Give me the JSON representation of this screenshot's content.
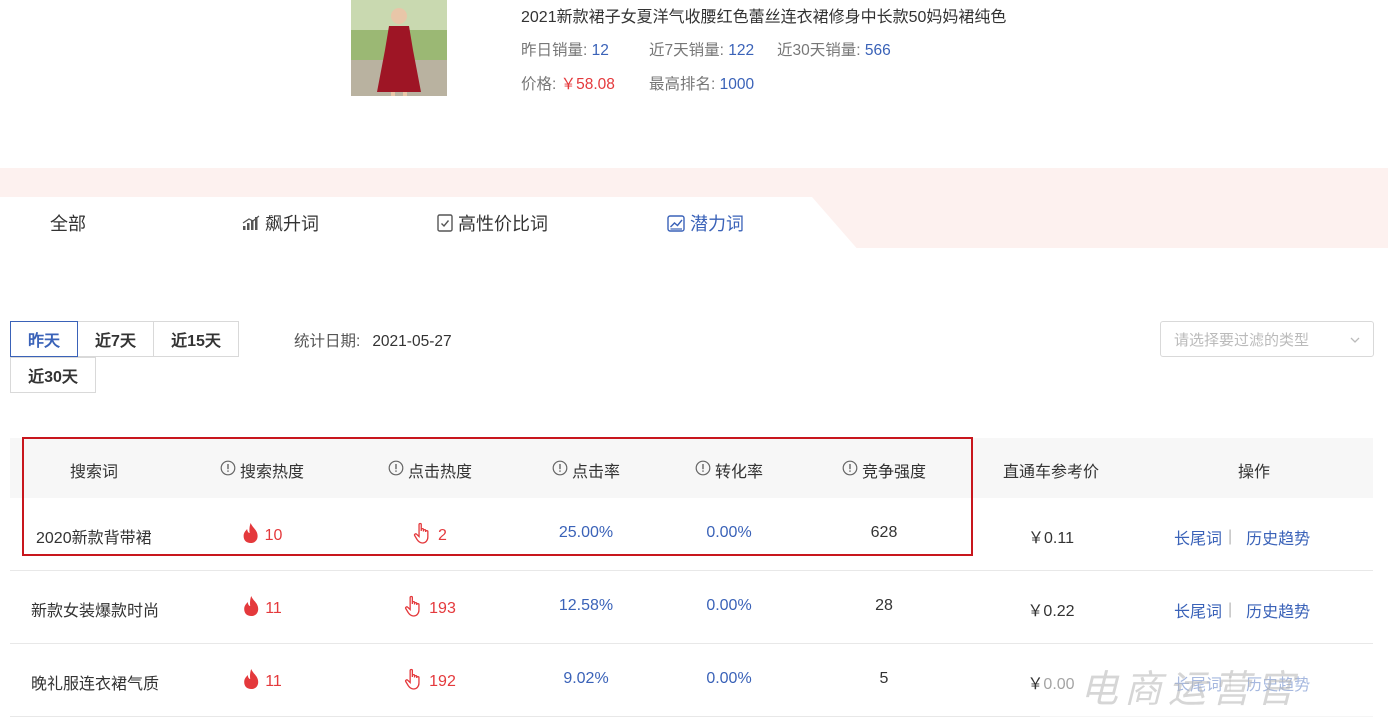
{
  "product": {
    "title": "2021新款裙子女夏洋气收腰红色蕾丝连衣裙修身中长款50妈妈裙纯色",
    "stats": [
      {
        "label": "昨日销量:",
        "value": "12"
      },
      {
        "label": "近7天销量:",
        "value": "122"
      },
      {
        "label": "近30天销量:",
        "value": "566"
      },
      {
        "label": "价格:",
        "value": "￥58.08"
      },
      {
        "label": "最高排名:",
        "value": "1000"
      }
    ]
  },
  "tabs": [
    {
      "label": "全部",
      "icon": "none"
    },
    {
      "label": "飙升词",
      "icon": "rising-bars-icon"
    },
    {
      "label": "高性价比词",
      "icon": "checkbox-doc-icon"
    },
    {
      "label": "潜力词",
      "icon": "chart-frame-icon",
      "active": true
    }
  ],
  "periods": [
    "昨天",
    "近7天",
    "近15天",
    "近30天"
  ],
  "active_period": "昨天",
  "date": {
    "label": "统计日期:",
    "value": "2021-05-27"
  },
  "filter": {
    "placeholder": "请选择要过滤的类型"
  },
  "table": {
    "headers": [
      "搜索词",
      "搜索热度",
      "点击热度",
      "点击率",
      "转化率",
      "竞争强度",
      "直通车参考价",
      "操作"
    ],
    "rows": [
      {
        "keyword": "2020新款背带裙",
        "search_heat": "10",
        "click_heat": "2",
        "ctr": "25.00%",
        "cvr": "0.00%",
        "competition": "628",
        "price": "￥0.11"
      },
      {
        "keyword": "新款女装爆款时尚",
        "search_heat": "11",
        "click_heat": "193",
        "ctr": "12.58%",
        "cvr": "0.00%",
        "competition": "28",
        "price": "￥0.22"
      },
      {
        "keyword": "晚礼服连衣裙气质",
        "search_heat": "11",
        "click_heat": "192",
        "ctr": "9.02%",
        "cvr": "0.00%",
        "competition": "5",
        "price": "￥0.00"
      }
    ],
    "actions": [
      "长尾词",
      "历史趋势"
    ]
  },
  "watermark": "电商运营官",
  "colors": {
    "accent": "#3a62b8",
    "heat": "#e4393c",
    "highlight": "#c8161d",
    "band": "#fdf1ef"
  }
}
